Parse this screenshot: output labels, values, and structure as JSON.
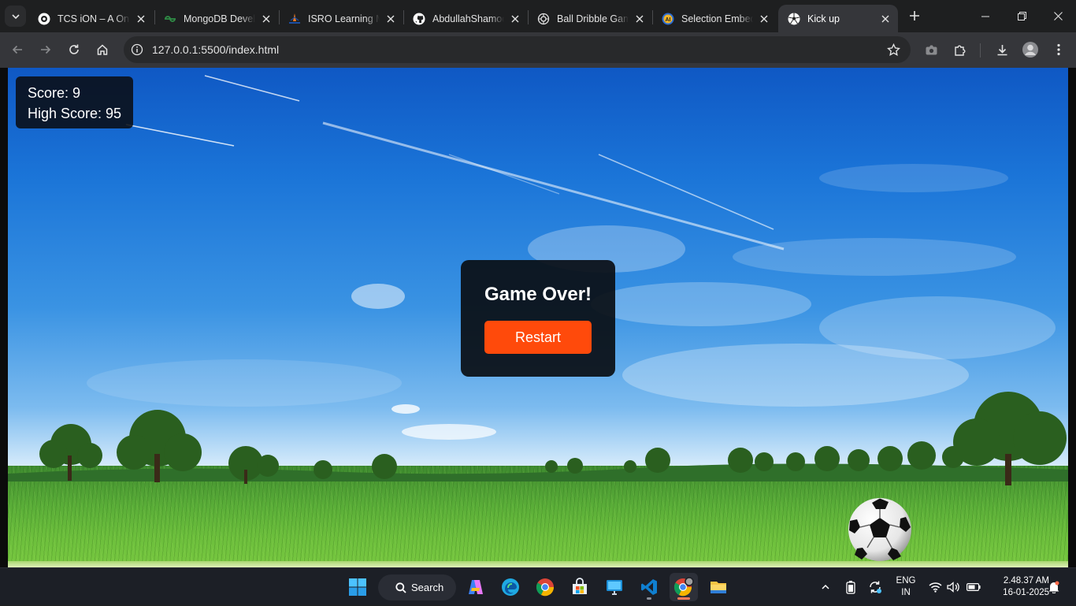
{
  "browser": {
    "tabs": [
      {
        "title": "TCS iON – A One Stop Solution",
        "icon": "tcs-ion-icon"
      },
      {
        "title": "MongoDB Developer",
        "icon": "geeksforgeeks-icon"
      },
      {
        "title": "ISRO Learning Management",
        "icon": "isro-icon"
      },
      {
        "title": "AbdullahShamoon",
        "icon": "github-icon"
      },
      {
        "title": "Ball Dribble Game",
        "icon": "openai-icon"
      },
      {
        "title": "Selection Embedding",
        "icon": "selection-icon"
      },
      {
        "title": "Kick up",
        "icon": "soccer-ball-icon",
        "active": true
      }
    ],
    "url": "127.0.0.1:5500/index.html"
  },
  "game": {
    "score_label": "Score: 9",
    "high_score_label": "High Score: 95",
    "game_over_title": "Game Over!",
    "restart_label": "Restart",
    "colors": {
      "restart": "#ff4a0b",
      "panel": "#0a0e14"
    }
  },
  "taskbar": {
    "search_label": "Search",
    "apps": [
      "windows-start-icon",
      "copilot-icon",
      "edge-icon",
      "chrome-icon",
      "store-icon",
      "remote-desktop-icon",
      "vscode-icon",
      "chrome-profile-icon",
      "file-explorer-icon"
    ],
    "lang_line1": "ENG",
    "lang_line2": "IN",
    "time": "2.48.37 AM",
    "date": "16-01-2025"
  }
}
